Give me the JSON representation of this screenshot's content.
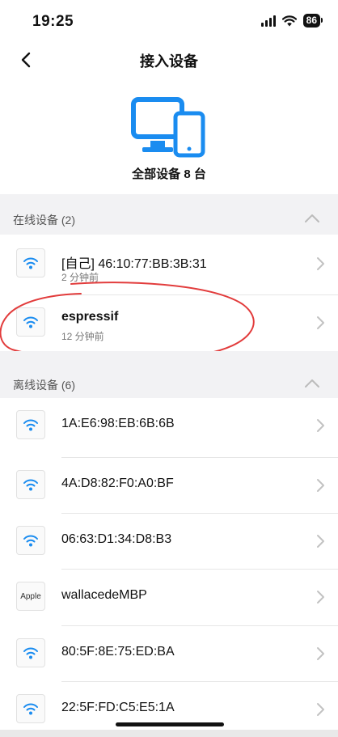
{
  "status_bar": {
    "time": "19:25",
    "battery": "86"
  },
  "nav": {
    "title": "接入设备",
    "back_icon": "chevron-left-icon"
  },
  "header": {
    "icon": "monitor-phone-icon",
    "total_label": "全部设备 8 台"
  },
  "online": {
    "title": "在线设备 (2)",
    "devices": [
      {
        "icon": "wifi-icon",
        "name": "[自己] 46:10:77:BB:3B:31",
        "time": "2 分钟前"
      },
      {
        "icon": "wifi-icon",
        "name": "espressif",
        "time": "12 分钟前"
      }
    ]
  },
  "offline": {
    "title": "离线设备 (6)",
    "devices": [
      {
        "icon": "wifi-icon",
        "name": "1A:E6:98:EB:6B:6B"
      },
      {
        "icon": "wifi-icon",
        "name": "4A:D8:82:F0:A0:BF"
      },
      {
        "icon": "wifi-icon",
        "name": "06:63:D1:34:D8:B3"
      },
      {
        "icon": "apple-icon",
        "icon_text": "Apple",
        "name": "wallacedeMBP"
      },
      {
        "icon": "wifi-icon",
        "name": "80:5F:8E:75:ED:BA"
      },
      {
        "icon": "wifi-icon",
        "name": "22:5F:FD:C5:E5:1A"
      }
    ]
  },
  "colors": {
    "accent_blue": "#1a8cf0",
    "annotation_red": "#e23c3c",
    "section_bg": "#f2f2f4"
  }
}
